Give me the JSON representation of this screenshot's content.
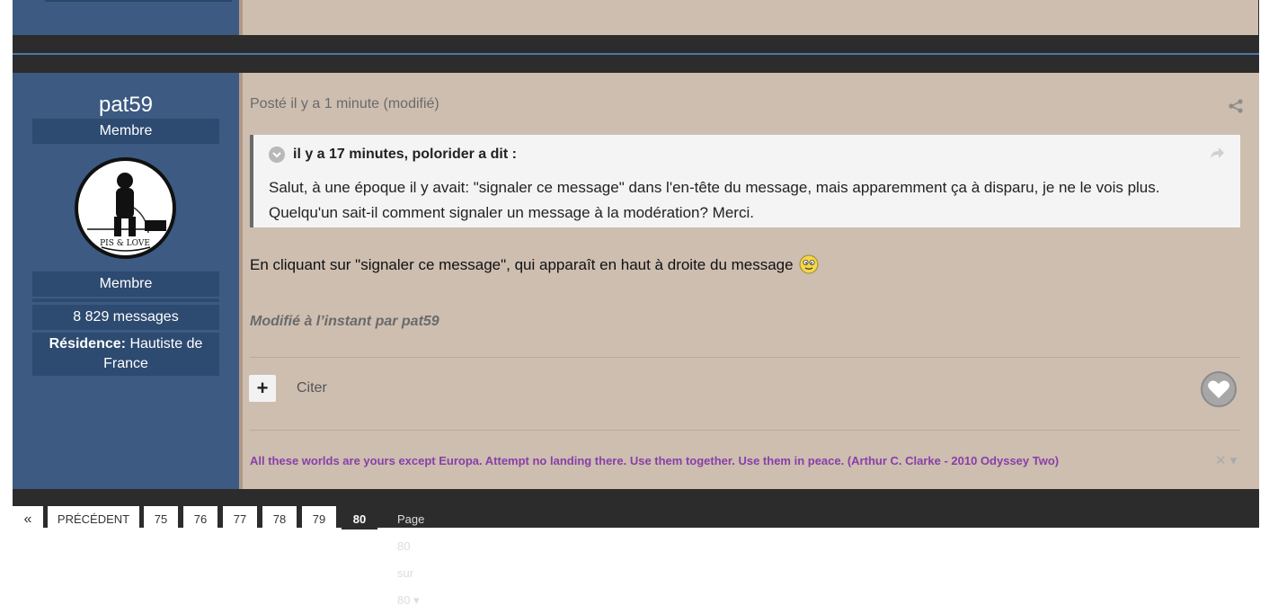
{
  "author": {
    "name": "pat59",
    "group": "Membre",
    "badge": "Membre",
    "posts": "8 829 messages",
    "residence_label": "Résidence:",
    "residence_value": "Hautiste de France"
  },
  "post": {
    "meta": "Posté il y a 1 minute (modifié)",
    "quote": {
      "citation": "il y a 17 minutes, polorider a dit :",
      "text": "Salut, à une époque il y avait: \"signaler ce message\" dans l'en-tête du message, mais apparemment ça à disparu, je ne le vois plus. Quelqu'un sait-il comment signaler un message à la modération? Merci."
    },
    "body": "En cliquant sur \"signaler ce message\", qui apparaît en haut à droite du message",
    "edited": "Modifié à l’instant par pat59",
    "plus_label": "+",
    "quote_button": "Citer",
    "signature": "All these worlds are yours except Europa. Attempt no landing there. Use them together. Use them in peace.  (Arthur C. Clarke - 2010 Odyssey Two)",
    "signature_close": "✕ ▾"
  },
  "pagination": {
    "first": "«",
    "prev": "PRÉCÉDENT",
    "pages": [
      "75",
      "76",
      "77",
      "78",
      "79",
      "80"
    ],
    "current": "80",
    "jump": "Page 80 sur 80 ▾"
  },
  "colors": {
    "author_bg": "#3c5a82",
    "post_bg": "#cdbeb0",
    "signature": "#8a3ea8"
  }
}
